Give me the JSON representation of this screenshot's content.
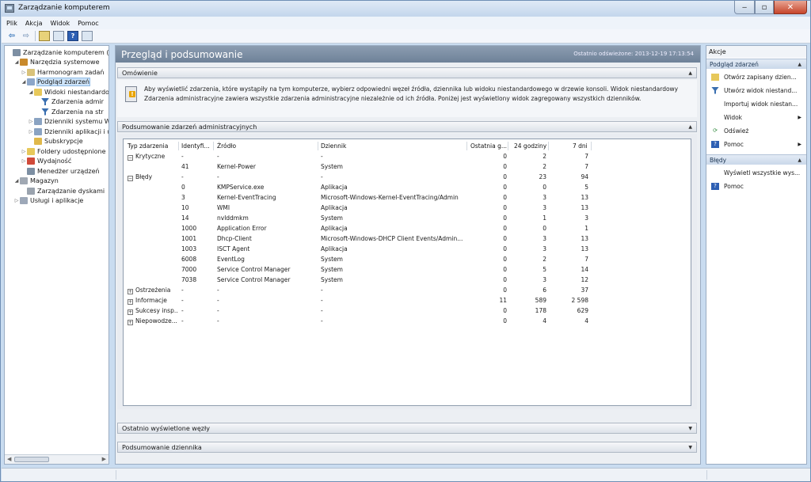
{
  "window": {
    "title": "Zarządzanie komputerem"
  },
  "menu": [
    "Plik",
    "Akcja",
    "Widok",
    "Pomoc"
  ],
  "tree": [
    {
      "label": "Zarządzanie komputerem (loka",
      "icon": "computer-management-icon",
      "expander": "",
      "indent": 0
    },
    {
      "label": "Narzędzia systemowe",
      "icon": "system-tools-icon",
      "expander": "◢",
      "indent": 1
    },
    {
      "label": "Harmonogram zadań",
      "icon": "task-scheduler-icon",
      "expander": "▷",
      "indent": 2
    },
    {
      "label": "Podgląd zdarzeń",
      "icon": "event-viewer-icon",
      "expander": "◢",
      "indent": 2,
      "selected": true
    },
    {
      "label": "Widoki niestandardo",
      "icon": "folder-icon",
      "expander": "◢",
      "indent": 3
    },
    {
      "label": "Zdarzenia admir",
      "icon": "filter-icon",
      "expander": "",
      "indent": 4
    },
    {
      "label": "Zdarzenia na str",
      "icon": "filter-icon",
      "expander": "",
      "indent": 4
    },
    {
      "label": "Dzienniki systemu W",
      "icon": "log-folder-icon",
      "expander": "▷",
      "indent": 3
    },
    {
      "label": "Dzienniki aplikacji i u",
      "icon": "log-folder-icon",
      "expander": "▷",
      "indent": 3
    },
    {
      "label": "Subskrypcje",
      "icon": "subscription-icon",
      "expander": "",
      "indent": 3
    },
    {
      "label": "Foldery udostępnione",
      "icon": "shared-folder-icon",
      "expander": "▷",
      "indent": 2
    },
    {
      "label": "Wydajność",
      "icon": "performance-icon",
      "expander": "▷",
      "indent": 2
    },
    {
      "label": "Menedżer urządzeń",
      "icon": "device-manager-icon",
      "expander": "",
      "indent": 2
    },
    {
      "label": "Magazyn",
      "icon": "storage-icon",
      "expander": "◢",
      "indent": 1
    },
    {
      "label": "Zarządzanie dyskami",
      "icon": "disk-management-icon",
      "expander": "",
      "indent": 2
    },
    {
      "label": "Usługi i aplikacje",
      "icon": "services-icon",
      "expander": "▷",
      "indent": 1
    }
  ],
  "center": {
    "title": "Przegląd i podsumowanie",
    "refreshed": "Ostatnio odświeżone: 2013-12-19 17:13:54",
    "overview_label": "Omówienie",
    "overview_text": "Aby wyświetlić zdarzenia, które wystąpiły na tym komputerze, wybierz odpowiedni węzeł źródła, dziennika lub widoku niestandardowego w drzewie konsoli. Widok niestandardowy Zdarzenia administracyjne zawiera wszystkie zdarzenia administracyjne niezależnie od ich źródła. Poniżej jest wyświetlony widok zagregowany wszystkich dzienników.",
    "summary_label": "Podsumowanie zdarzeń administracyjnych",
    "recent_label": "Ostatnio wyświetlone węzły",
    "logsummary_label": "Podsumowanie dziennika"
  },
  "table": {
    "headers": [
      "Typ zdarzenia",
      "Identyfi...",
      "Źródło",
      "Dziennik",
      "Ostatnia g...",
      "24 godziny",
      "7 dni"
    ],
    "rows": [
      {
        "type": "Krytyczne",
        "group": true,
        "id": "-",
        "source": "-",
        "log": "-",
        "hour": "0",
        "day": "2",
        "week": "7"
      },
      {
        "type": "",
        "id": "41",
        "source": "Kernel-Power",
        "log": "System",
        "hour": "0",
        "day": "2",
        "week": "7"
      },
      {
        "type": "Błędy",
        "group": true,
        "id": "-",
        "source": "-",
        "log": "-",
        "hour": "0",
        "day": "23",
        "week": "94"
      },
      {
        "type": "",
        "id": "0",
        "source": "KMPService.exe",
        "log": "Aplikacja",
        "hour": "0",
        "day": "0",
        "week": "5"
      },
      {
        "type": "",
        "id": "3",
        "source": "Kernel-EventTracing",
        "log": "Microsoft-Windows-Kernel-EventTracing/Admin",
        "hour": "0",
        "day": "3",
        "week": "13"
      },
      {
        "type": "",
        "id": "10",
        "source": "WMI",
        "log": "Aplikacja",
        "hour": "0",
        "day": "3",
        "week": "13"
      },
      {
        "type": "",
        "id": "14",
        "source": "nvlddmkm",
        "log": "System",
        "hour": "0",
        "day": "1",
        "week": "3"
      },
      {
        "type": "",
        "id": "1000",
        "source": "Application Error",
        "log": "Aplikacja",
        "hour": "0",
        "day": "0",
        "week": "1"
      },
      {
        "type": "",
        "id": "1001",
        "source": "Dhcp-Client",
        "log": "Microsoft-Windows-DHCP Client Events/Admin...",
        "hour": "0",
        "day": "3",
        "week": "13"
      },
      {
        "type": "",
        "id": "1003",
        "source": "ISCT Agent",
        "log": "Aplikacja",
        "hour": "0",
        "day": "3",
        "week": "13"
      },
      {
        "type": "",
        "id": "6008",
        "source": "EventLog",
        "log": "System",
        "hour": "0",
        "day": "2",
        "week": "7"
      },
      {
        "type": "",
        "id": "7000",
        "source": "Service Control Manager",
        "log": "System",
        "hour": "0",
        "day": "5",
        "week": "14"
      },
      {
        "type": "",
        "id": "7038",
        "source": "Service Control Manager",
        "log": "System",
        "hour": "0",
        "day": "3",
        "week": "12"
      },
      {
        "type": "Ostrzeżenia",
        "group": true,
        "collapsed": true,
        "id": "-",
        "source": "-",
        "log": "-",
        "hour": "0",
        "day": "6",
        "week": "37"
      },
      {
        "type": "Informacje",
        "group": true,
        "collapsed": true,
        "id": "-",
        "source": "-",
        "log": "-",
        "hour": "11",
        "day": "589",
        "week": "2 598"
      },
      {
        "type": "Sukcesy insp...",
        "group": true,
        "collapsed": true,
        "id": "-",
        "source": "-",
        "log": "-",
        "hour": "0",
        "day": "178",
        "week": "629"
      },
      {
        "type": "Niepowodze...",
        "group": true,
        "collapsed": true,
        "id": "-",
        "source": "-",
        "log": "-",
        "hour": "0",
        "day": "4",
        "week": "4"
      }
    ]
  },
  "actions": {
    "title": "Akcje",
    "sections": [
      {
        "label": "Podgląd zdarzeń",
        "items": [
          {
            "label": "Otwórz zapisany dzien...",
            "icon": "open-folder-icon"
          },
          {
            "label": "Utwórz widok niestand...",
            "icon": "filter-icon"
          },
          {
            "label": "Importuj widok niestan...",
            "icon": ""
          },
          {
            "label": "Widok",
            "icon": "",
            "submenu": true
          },
          {
            "label": "Odśwież",
            "icon": "refresh-icon"
          },
          {
            "label": "Pomoc",
            "icon": "help-icon",
            "submenu": true
          }
        ]
      },
      {
        "label": "Błędy",
        "items": [
          {
            "label": "Wyświetl wszystkie wys...",
            "icon": ""
          },
          {
            "label": "Pomoc",
            "icon": "help-icon"
          }
        ]
      }
    ]
  },
  "colors": {
    "header": "#7b8ea5",
    "selection": "#cde4fa",
    "accent": "#2d5fb3",
    "warning": "#e9a400"
  }
}
